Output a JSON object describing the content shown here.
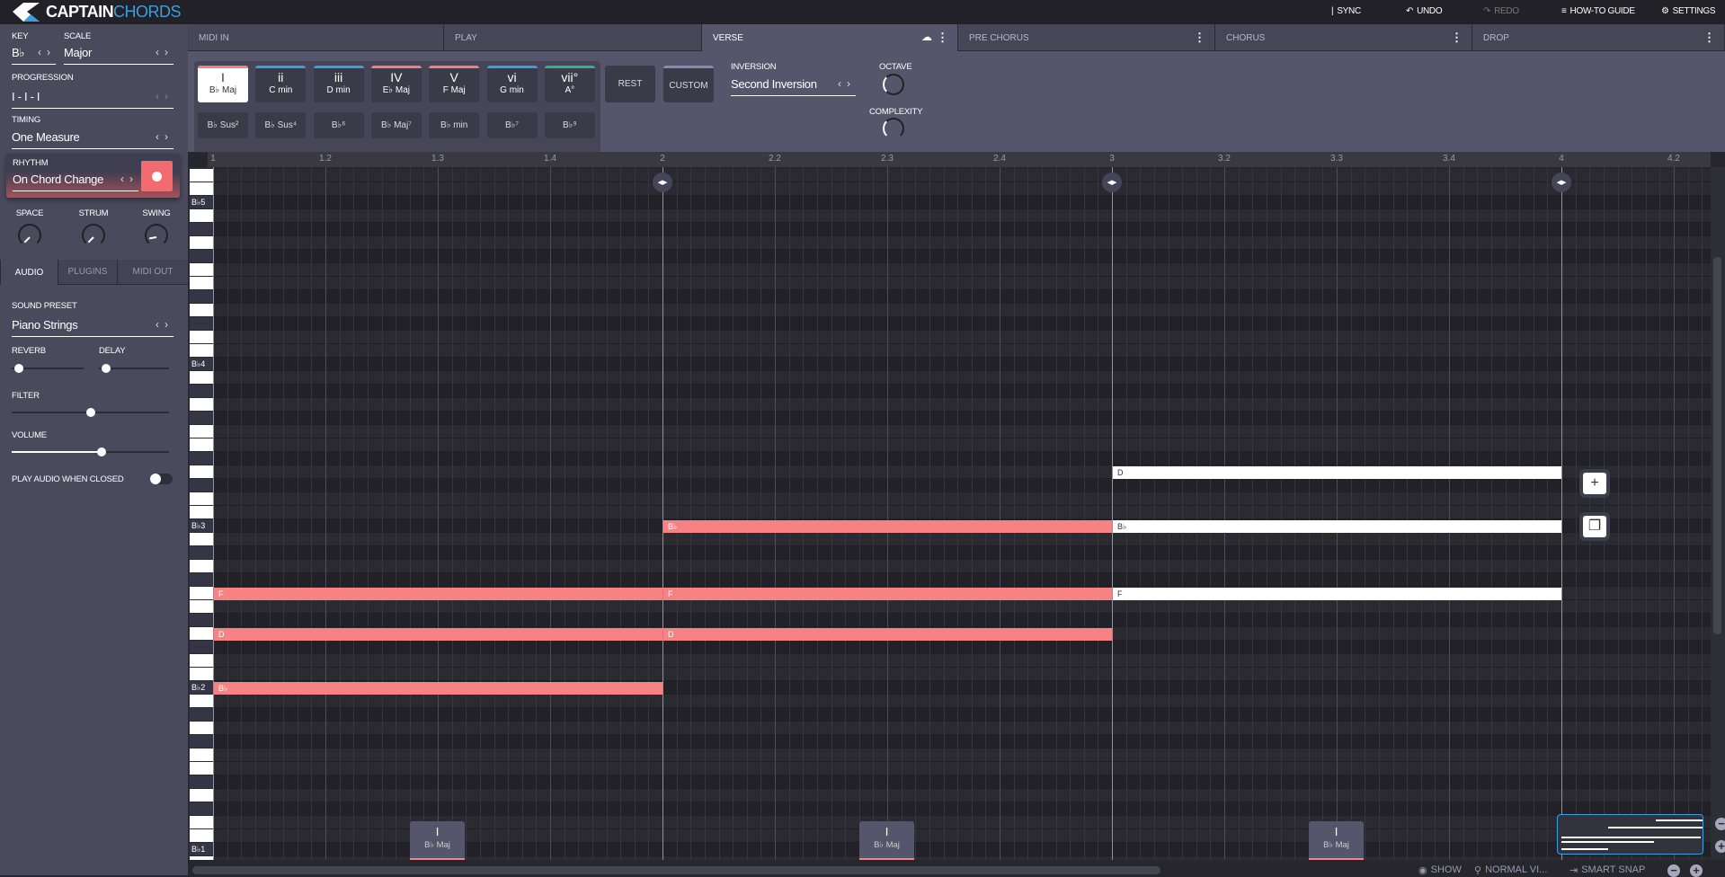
{
  "app": {
    "brand_1": "CAPTAIN",
    "brand_2": "CHORDS"
  },
  "toolbar": {
    "sync": "SYNC",
    "undo": "UNDO",
    "redo": "REDO",
    "guide": "HOW-TO GUIDE",
    "settings": "SETTINGS"
  },
  "left": {
    "key_label": "KEY",
    "key_value": "B♭",
    "scale_label": "SCALE",
    "scale_value": "Major",
    "progression_label": "PROGRESSION",
    "progression_value": "I - I - I",
    "timing_label": "TIMING",
    "timing_value": "One Measure",
    "rhythm_label": "RHYTHM",
    "rhythm_value": "On Chord Change",
    "knobs": [
      {
        "label": "SPACE"
      },
      {
        "label": "STRUM"
      },
      {
        "label": "SWING"
      }
    ],
    "tabs": [
      "AUDIO",
      "PLUGINS",
      "MIDI OUT"
    ],
    "sound_preset_label": "SOUND PRESET",
    "sound_preset_value": "Piano Strings",
    "reverb_label": "REVERB",
    "reverb": 0.1,
    "delay_label": "DELAY",
    "delay": 0.1,
    "filter_label": "FILTER",
    "filter": 0.5,
    "volume_label": "VOLUME",
    "volume": 0.57,
    "play_closed_label": "PLAY AUDIO WHEN CLOSED",
    "play_closed": false
  },
  "sections": [
    {
      "label": "MIDI IN"
    },
    {
      "label": "PLAY"
    },
    {
      "label": "VERSE",
      "active": true
    },
    {
      "label": "PRE CHORUS"
    },
    {
      "label": "CHORUS"
    },
    {
      "label": "DROP"
    }
  ],
  "chords": [
    {
      "num": "I",
      "name": "B♭ Maj",
      "color": "#f47f80",
      "active": true
    },
    {
      "num": "ii",
      "name": "C min",
      "color": "#3a9ee0"
    },
    {
      "num": "iii",
      "name": "D min",
      "color": "#3a9ee0"
    },
    {
      "num": "IV",
      "name": "E♭ Maj",
      "color": "#f47f80"
    },
    {
      "num": "V",
      "name": "F Maj",
      "color": "#f47f80"
    },
    {
      "num": "vi",
      "name": "G min",
      "color": "#3a9ee0"
    },
    {
      "num": "vii°",
      "name": "A°",
      "color": "#2fb38a"
    }
  ],
  "extensions": [
    "B♭ Sus²",
    "B♭ Sus⁴",
    "B♭⁶",
    "B♭ Maj⁷",
    "B♭ min",
    "B♭⁷",
    "B♭⁹"
  ],
  "rest_label": "REST",
  "custom_label": "CUSTOM",
  "inversion_label": "INVERSION",
  "inversion_value": "Second Inversion",
  "octave_label": "OCTAVE",
  "complexity_label": "COMPLEXITY",
  "ruler": [
    "1",
    "1.2",
    "1.3",
    "1.4",
    "2",
    "2.2",
    "2.3",
    "2.4",
    "3",
    "3.2",
    "3.3",
    "3.4",
    "4",
    "4.2"
  ],
  "key_labels": {
    "Bb5": "B♭5",
    "Bb4": "B♭4",
    "Bb3": "B♭3",
    "Bb2": "B♭2",
    "Bb1": "B♭1"
  },
  "notes": [
    {
      "label": "B♭",
      "pitch": "Bb2",
      "start": 1,
      "end": 2,
      "state": "active"
    },
    {
      "label": "D",
      "pitch": "D3",
      "start": 1,
      "end": 2,
      "state": "active"
    },
    {
      "label": "F",
      "pitch": "F3",
      "start": 1,
      "end": 2,
      "state": "active"
    },
    {
      "label": "D",
      "pitch": "D3",
      "start": 2,
      "end": 3,
      "state": "active"
    },
    {
      "label": "F",
      "pitch": "F3",
      "start": 2,
      "end": 3,
      "state": "active"
    },
    {
      "label": "B♭",
      "pitch": "Bb3",
      "start": 2,
      "end": 3,
      "state": "active"
    },
    {
      "label": "F",
      "pitch": "F3",
      "start": 3,
      "end": 4,
      "state": "inactive"
    },
    {
      "label": "B♭",
      "pitch": "Bb3",
      "start": 3,
      "end": 4,
      "state": "inactive"
    },
    {
      "label": "D",
      "pitch": "D4",
      "start": 3,
      "end": 4,
      "state": "inactive"
    }
  ],
  "chord_pads": [
    {
      "num": "I",
      "name": "B♭ Maj",
      "measure": 1
    },
    {
      "num": "I",
      "name": "B♭ Maj",
      "measure": 2
    },
    {
      "num": "I",
      "name": "B♭ Maj",
      "measure": 3
    }
  ],
  "status": {
    "show": "SHOW",
    "view": "NORMAL VI...",
    "snap": "SMART SNAP"
  }
}
